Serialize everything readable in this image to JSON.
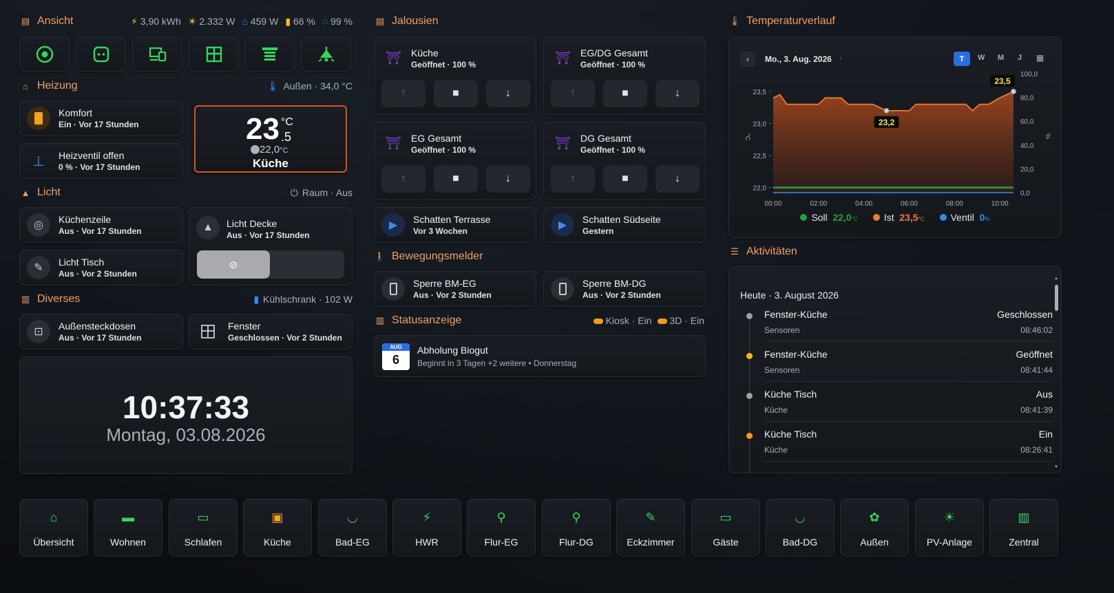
{
  "ansicht": {
    "title": "Ansicht",
    "stats": [
      {
        "icon": "energy-icon",
        "value": "3,90 kWh"
      },
      {
        "icon": "solar-icon",
        "value": "2.332 W"
      },
      {
        "icon": "home-power-icon",
        "value": "459 W"
      },
      {
        "icon": "battery-icon",
        "value": "66 %"
      },
      {
        "icon": "autarky-icon",
        "value": "99 %"
      }
    ],
    "nav": [
      "eye-icon",
      "socket-icon",
      "devices-icon",
      "window-icon",
      "shutter-icon",
      "ceiling-light-icon"
    ]
  },
  "heizung": {
    "title": "Heizung",
    "outside": "Außen · 34,0 °C",
    "tiles": [
      {
        "name": "Komfort",
        "state": "Ein · Vor 17 Stunden"
      },
      {
        "name": "Heizventil offen",
        "state": "0 % · Vor 17 Stunden"
      }
    ],
    "thermostat": {
      "temp_int": "23",
      "temp_dec": ".5",
      "unit": "°C",
      "target": "22,0",
      "target_unit": "°C",
      "room": "Küche"
    }
  },
  "licht": {
    "title": "Licht",
    "right": "Raum · Aus",
    "tiles": [
      {
        "name": "Küchenzeile",
        "state": "Aus · Vor 17 Stunden"
      },
      {
        "name": "Licht Tisch",
        "state": "Aus · Vor 2 Stunden"
      }
    ],
    "decke": {
      "name": "Licht Decke",
      "state": "Aus · Vor 17 Stunden"
    }
  },
  "diverses": {
    "title": "Diverses",
    "right": "Kühlschrank · 102 W",
    "tiles": [
      {
        "name": "Außensteckdosen",
        "state": "Aus · Vor 17 Stunden"
      },
      {
        "name": "Fenster",
        "state": "Geschlossen · Vor 2 Stunden"
      }
    ]
  },
  "clock": {
    "time": "10:37:33",
    "date": "Montag, 03.08.2026"
  },
  "jalousien": {
    "title": "Jalousien",
    "covers": [
      {
        "name": "Küche",
        "state": "Geöffnet · 100 %"
      },
      {
        "name": "EG/DG Gesamt",
        "state": "Geöffnet · 100 %"
      },
      {
        "name": "EG Gesamt",
        "state": "Geöffnet · 100 %"
      },
      {
        "name": "DG Gesamt",
        "state": "Geöffnet · 100 %"
      }
    ],
    "scenes": [
      {
        "name": "Schatten Terrasse",
        "state": "Vor 3 Wochen"
      },
      {
        "name": "Schatten Südseite",
        "state": "Gestern"
      }
    ]
  },
  "bewegung": {
    "title": "Bewegungsmelder",
    "tiles": [
      {
        "name": "Sperre BM-EG",
        "state": "Aus · Vor 2 Stunden"
      },
      {
        "name": "Sperre BM-DG",
        "state": "Aus · Vor 2 Stunden"
      }
    ]
  },
  "status": {
    "title": "Statusanzeige",
    "kiosk": "Kiosk · Ein",
    "threed": "3D · Ein",
    "event": {
      "month": "AUG",
      "day": "6",
      "title": "Abholung Biogut",
      "sub": "Beginnt in 3 Tagen +2 weitere • Donnerstag"
    }
  },
  "temperatur": {
    "title": "Temperaturverlauf",
    "date": "Mo., 3. Aug. 2026",
    "ranges": [
      "T",
      "W",
      "M",
      "J"
    ],
    "active_range": "T",
    "legend": [
      {
        "name": "Soll",
        "value": "22,0",
        "unit": "°C",
        "color": "#22a33a"
      },
      {
        "name": "Ist",
        "value": "23,5",
        "unit": "°C",
        "color": "#f07a3c"
      },
      {
        "name": "Ventil",
        "value": "0",
        "unit": "%",
        "color": "#2f8cf0"
      }
    ],
    "tooltip_max": "23,5",
    "tooltip_min": "23,2"
  },
  "chart_data": {
    "type": "line",
    "x_ticks": [
      "00:00",
      "02:00",
      "04:00",
      "06:00",
      "08:00",
      "10:00"
    ],
    "y_left_ticks": [
      "22,0",
      "22,5",
      "23,0",
      "23,5"
    ],
    "y_right_ticks": [
      "0,0",
      "20,0",
      "40,0",
      "60,0",
      "80,0",
      "100,0"
    ],
    "ylabel_left": "°C",
    "ylabel_right": "%",
    "ylim_left": [
      21.9,
      23.65
    ],
    "ylim_right": [
      0,
      100
    ],
    "xlim": [
      0,
      10.6
    ],
    "series": [
      {
        "name": "Ist",
        "color": "#f07a3c",
        "x": [
          0,
          0.3,
          0.6,
          1.0,
          1.5,
          2.0,
          2.3,
          2.6,
          3.0,
          3.3,
          3.6,
          4.0,
          4.4,
          4.7,
          5.0,
          5.5,
          6.0,
          6.3,
          6.6,
          7.0,
          7.5,
          8.0,
          8.5,
          8.8,
          9.1,
          9.5,
          10.0,
          10.6
        ],
        "y": [
          23.4,
          23.45,
          23.3,
          23.3,
          23.3,
          23.3,
          23.4,
          23.4,
          23.4,
          23.3,
          23.3,
          23.3,
          23.3,
          23.25,
          23.2,
          23.2,
          23.2,
          23.3,
          23.3,
          23.3,
          23.3,
          23.3,
          23.3,
          23.2,
          23.3,
          23.3,
          23.4,
          23.5
        ]
      },
      {
        "name": "Soll",
        "color": "#22a33a",
        "x": [
          0,
          10.6
        ],
        "y": [
          22.0,
          22.0
        ]
      },
      {
        "name": "Ventil",
        "color": "#2f8cf0",
        "x": [
          0,
          10.6
        ],
        "y": [
          0,
          0
        ]
      }
    ]
  },
  "aktivitaeten": {
    "title": "Aktivitäten",
    "day": "Heute · 3. August 2026",
    "rows": [
      {
        "entity": "Fenster-Küche",
        "area": "Sensoren",
        "state": "Geschlossen",
        "time": "08:46:02",
        "dot": "#9aa0a8"
      },
      {
        "entity": "Fenster-Küche",
        "area": "Sensoren",
        "state": "Geöffnet",
        "time": "08:41:44",
        "dot": "#f5b81c"
      },
      {
        "entity": "Küche Tisch",
        "area": "Küche",
        "state": "Aus",
        "time": "08:41:39",
        "dot": "#9aa0a8"
      },
      {
        "entity": "Küche Tisch",
        "area": "Küche",
        "state": "Ein",
        "time": "08:26:41",
        "dot": "#f59a1c"
      }
    ]
  },
  "bottom_nav": [
    {
      "label": "Übersicht",
      "icon": "home-icon"
    },
    {
      "label": "Wohnen",
      "icon": "sofa-icon"
    },
    {
      "label": "Schlafen",
      "icon": "bed-icon"
    },
    {
      "label": "Küche",
      "icon": "stove-icon"
    },
    {
      "label": "Bad-EG",
      "icon": "bathtub-icon"
    },
    {
      "label": "HWR",
      "icon": "lightning-icon"
    },
    {
      "label": "Flur-EG",
      "icon": "coat-rack-icon"
    },
    {
      "label": "Flur-DG",
      "icon": "coat-rack-icon"
    },
    {
      "label": "Eckzimmer",
      "icon": "desk-icon"
    },
    {
      "label": "Gäste",
      "icon": "guest-bed-icon"
    },
    {
      "label": "Bad-DG",
      "icon": "bathtub-icon"
    },
    {
      "label": "Außen",
      "icon": "flower-icon"
    },
    {
      "label": "PV-Anlage",
      "icon": "solar-panel-icon"
    },
    {
      "label": "Zentral",
      "icon": "building-icon"
    }
  ]
}
